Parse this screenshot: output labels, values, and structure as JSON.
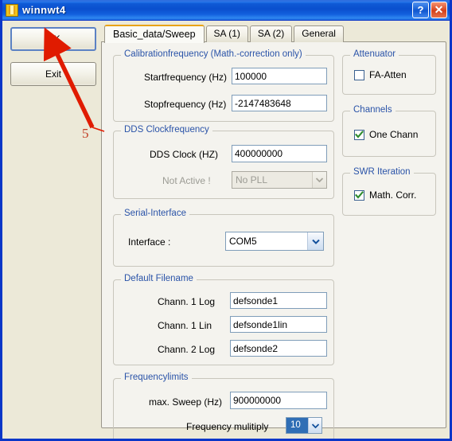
{
  "window": {
    "title": "winnwt4",
    "icon": "app-icon",
    "help_button": "?",
    "close_button": "✕"
  },
  "side_buttons": {
    "ok_label": "OK",
    "exit_label": "Exit"
  },
  "annotation": {
    "step_number": "5",
    "color": "#C23B22"
  },
  "tabs": [
    {
      "label": "Basic_data/Sweep",
      "active": true
    },
    {
      "label": "SA (1)",
      "active": false
    },
    {
      "label": "SA (2)",
      "active": false
    },
    {
      "label": "General",
      "active": false
    }
  ],
  "groups": {
    "calibration": {
      "title": "Calibrationfrequency (Math.-correction only)",
      "fields": [
        {
          "label": "Startfrequency (Hz)",
          "value": "100000"
        },
        {
          "label": "Stopfrequency (Hz)",
          "value": "-2147483648"
        }
      ]
    },
    "dds": {
      "title": "DDS Clockfrequency",
      "clock_label": "DDS Clock (HZ)",
      "clock_value": "400000000",
      "pll_label": "Not Active !",
      "pll_value": "No PLL"
    },
    "serial": {
      "title": "Serial-Interface",
      "interface_label": "Interface :",
      "interface_value": "COM5"
    },
    "filenames": {
      "title": "Default Filename",
      "fields": [
        {
          "label": "Chann. 1  Log",
          "value": "defsonde1"
        },
        {
          "label": "Chann. 1  Lin",
          "value": "defsonde1lin"
        },
        {
          "label": "Chann. 2 Log",
          "value": "defsonde2"
        }
      ]
    },
    "freqlimits": {
      "title": "Frequencylimits",
      "sweep_label": "max. Sweep (Hz)",
      "sweep_value": "900000000",
      "multiply_label": "Frequency mulitiply",
      "multiply_value": "10"
    },
    "attenuator": {
      "title": "Attenuator",
      "checkbox_label": "FA-Atten",
      "checked": false
    },
    "channels": {
      "title": "Channels",
      "checkbox_label": "One Chann",
      "checked": true
    },
    "swr": {
      "title": "SWR Iteration",
      "checkbox_label": "Math. Corr.",
      "checked": true
    }
  },
  "colors": {
    "titlebar_blue": "#0A4FCE",
    "dialog_bg": "#ECE9D8",
    "panel_bg": "#F4F3EE",
    "group_label": "#2A53A8",
    "check_green": "#2E8B2E",
    "annotation_red": "#E01B00"
  }
}
